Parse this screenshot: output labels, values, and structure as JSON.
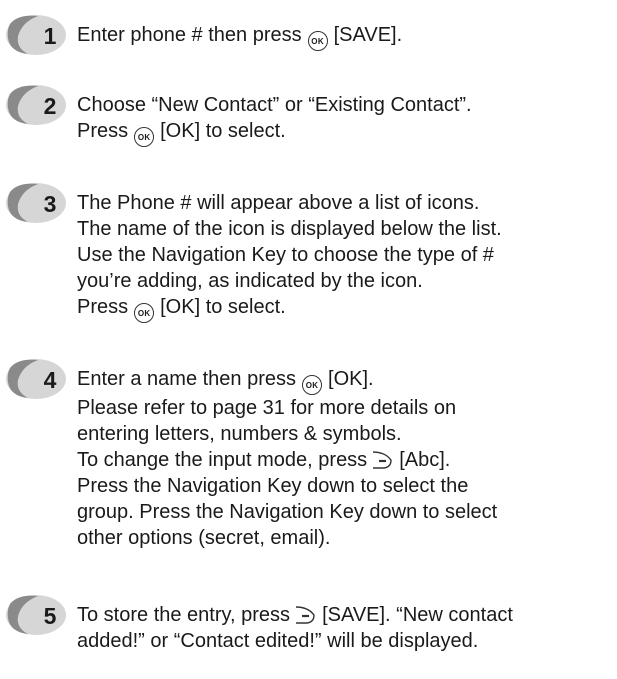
{
  "steps": [
    {
      "number": "1",
      "lines": [
        {
          "before": "Enter phone # then press",
          "icon": "ok-key-icon",
          "after": "[SAVE]."
        }
      ]
    },
    {
      "number": "2",
      "lines": [
        {
          "before": "Choose “New Contact” or “Existing Contact”."
        },
        {
          "before": "Press",
          "icon": "ok-key-icon",
          "after": "[OK] to select."
        }
      ]
    },
    {
      "number": "3",
      "lines": [
        {
          "before": "The Phone # will appear above a list of icons."
        },
        {
          "before": "The name of the icon is displayed below the list."
        },
        {
          "before": "Use the Navigation Key to choose the type of #"
        },
        {
          "before": "you’re adding, as indicated by the icon."
        },
        {
          "before": "Press",
          "icon": "ok-key-icon",
          "after": "[OK] to select."
        }
      ]
    },
    {
      "number": "4",
      "lines": [
        {
          "before": "Enter a name then press",
          "icon": "ok-key-icon",
          "after": "[OK]."
        },
        {
          "before": "Please refer to page 31 for more details on"
        },
        {
          "before": "entering letters, numbers & symbols."
        },
        {
          "before": "To change the input mode, press",
          "icon": "right-soft-key-icon",
          "after": "[Abc]."
        },
        {
          "before": "Press the Navigation Key down to select the"
        },
        {
          "before": "group. Press the Navigation Key down to select"
        },
        {
          "before": "other options (secret, email)."
        }
      ]
    },
    {
      "number": "5",
      "lines": [
        {
          "before": "To store the entry, press",
          "icon": "right-soft-key-icon",
          "after": "[SAVE]. “New contact"
        },
        {
          "before": "added!” or “Contact edited!” will be displayed."
        }
      ]
    }
  ],
  "ok_icon_text": "OK",
  "colors": {
    "badge_dark": "#7a7a7a",
    "badge_light": "#d6d6d6",
    "badge_number": "#ffffff",
    "text": "#1a1a1a"
  }
}
